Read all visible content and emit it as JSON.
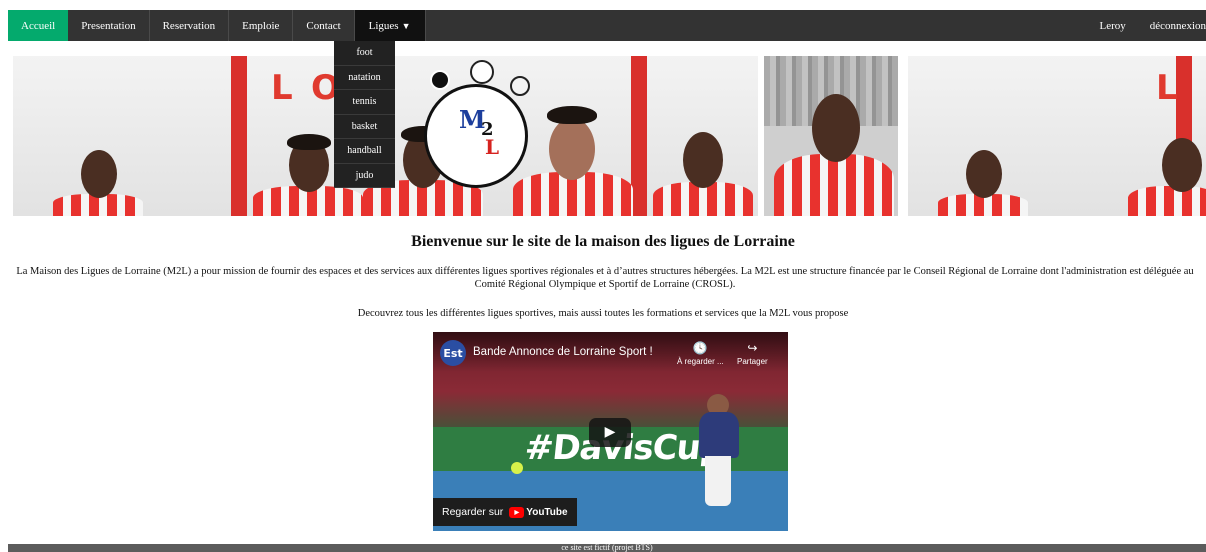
{
  "nav": {
    "left": [
      "Accueil",
      "Presentation",
      "Reservation",
      "Emploie",
      "Contact"
    ],
    "dropdown_label": "Ligues",
    "dropdown_caret": "▼",
    "right": [
      "Leroy",
      "déconnexion"
    ]
  },
  "dropdown": {
    "items": [
      "foot",
      "natation",
      "tennis",
      "basket",
      "handball",
      "judo"
    ]
  },
  "banner": {
    "logo_letters": [
      "L",
      "O",
      "L",
      "O"
    ]
  },
  "main": {
    "title": "Bienvenue sur le site de la maison des ligues de Lorraine",
    "intro": "La Maison des Ligues de Lorraine (M2L) a pour mission de fournir des espaces et des services aux différentes ligues sportives régionales et à d’autres structures hébergées. La M2L est une structure financée par le Conseil Régional de Lorraine dont l'administration est déléguée au Comité Régional Olympique et Sportif de Lorraine (CROSL).",
    "sub": "Decouvrez tous les différentes ligues sportives, mais aussi toutes les formations et services que la M2L vous propose"
  },
  "video": {
    "title": "Bande Annonce de Lorraine Sport !",
    "channel_abbr": "Est",
    "watch_later": "À regarder ...",
    "share": "Partager",
    "hashtag": "#DavisCup",
    "watch_on": "Regarder sur",
    "youtube": "YouTube"
  },
  "footer": {
    "text": "ce site est fictif (projet BTS)"
  },
  "colors": {
    "nav_bg": "#333333",
    "active": "#04AA6D",
    "dropdown_bg": "#222222",
    "footer_bg": "#5c5c5c"
  }
}
